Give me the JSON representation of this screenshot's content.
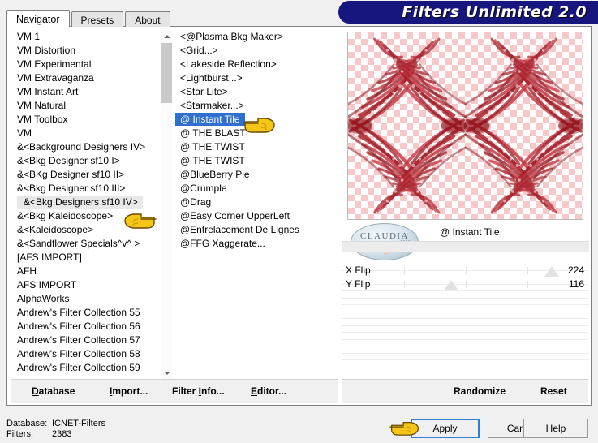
{
  "window": {
    "title": "Filters Unlimited 2.0",
    "accent_blue": "#16167e",
    "selection_blue": "#2f6fd0"
  },
  "tabs": [
    {
      "label": "Navigator",
      "active": true
    },
    {
      "label": "Presets",
      "active": false
    },
    {
      "label": "About",
      "active": false
    }
  ],
  "category_list": {
    "items": [
      {
        "label": "VM 1",
        "selected": false
      },
      {
        "label": "VM Distortion",
        "selected": false
      },
      {
        "label": "VM Experimental",
        "selected": false
      },
      {
        "label": "VM Extravaganza",
        "selected": false
      },
      {
        "label": "VM Instant Art",
        "selected": false
      },
      {
        "label": "VM Natural",
        "selected": false
      },
      {
        "label": "VM Toolbox",
        "selected": false
      },
      {
        "label": "VM",
        "selected": false
      },
      {
        "label": "&<Background Designers IV>",
        "selected": false
      },
      {
        "label": "&<Bkg Designer sf10 I>",
        "selected": false
      },
      {
        "label": "&<BKg Designer sf10 II>",
        "selected": false
      },
      {
        "label": "&<Bkg Designer sf10 III>",
        "selected": false
      },
      {
        "label": "&<Bkg Designers sf10 IV>",
        "selected": true
      },
      {
        "label": "&<Bkg Kaleidoscope>",
        "selected": false
      },
      {
        "label": "&<Kaleidoscope>",
        "selected": false
      },
      {
        "label": "&<Sandflower Specials^v^ >",
        "selected": false
      },
      {
        "label": "[AFS IMPORT]",
        "selected": false
      },
      {
        "label": "AFH",
        "selected": false
      },
      {
        "label": "AFS IMPORT",
        "selected": false
      },
      {
        "label": "AlphaWorks",
        "selected": false
      },
      {
        "label": "Andrew's Filter Collection 55",
        "selected": false
      },
      {
        "label": "Andrew's Filter Collection 56",
        "selected": false
      },
      {
        "label": "Andrew's Filter Collection 57",
        "selected": false
      },
      {
        "label": "Andrew's Filter Collection 58",
        "selected": false
      },
      {
        "label": "Andrew's Filter Collection 59",
        "selected": false
      }
    ],
    "scroll_up_icon": "chevron-up-icon",
    "scroll_down_icon": "chevron-down-icon"
  },
  "filter_list": {
    "items": [
      {
        "label": "<@Plasma Bkg Maker>",
        "selected": false
      },
      {
        "label": "<Grid...>",
        "selected": false
      },
      {
        "label": "<Lakeside Reflection>",
        "selected": false
      },
      {
        "label": "<Lightburst...>",
        "selected": false
      },
      {
        "label": "<Star Lite>",
        "selected": false
      },
      {
        "label": "<Starmaker...>",
        "selected": false
      },
      {
        "label": "@ Instant Tile",
        "selected": true
      },
      {
        "label": "@ THE BLAST",
        "selected": false
      },
      {
        "label": "@ THE TWIST",
        "selected": false
      },
      {
        "label": "@ THE TWIST",
        "selected": false
      },
      {
        "label": "@BlueBerry Pie",
        "selected": false
      },
      {
        "label": "@Crumple",
        "selected": false
      },
      {
        "label": "@Drag",
        "selected": false
      },
      {
        "label": "@Easy Corner UpperLeft",
        "selected": false
      },
      {
        "label": "@Entrelacement De Lignes",
        "selected": false
      },
      {
        "label": "@FFG Xaggerate...",
        "selected": false
      }
    ]
  },
  "preview": {
    "filter_name": "@ Instant Tile",
    "watermark": {
      "text": "CLAUDIA",
      "subtext": "2010",
      "icon": "dog-icon"
    }
  },
  "sliders": [
    {
      "label": "X Flip",
      "value": "224",
      "percent": 85
    },
    {
      "label": "Y Flip",
      "value": "116",
      "percent": 44
    },
    {
      "label": "",
      "value": "",
      "percent": -1
    },
    {
      "label": "",
      "value": "",
      "percent": -1
    },
    {
      "label": "",
      "value": "",
      "percent": -1
    },
    {
      "label": "",
      "value": "",
      "percent": -1
    },
    {
      "label": "",
      "value": "",
      "percent": -1
    }
  ],
  "panel_actions": {
    "randomize_label": "Randomize",
    "reset_label": "Reset"
  },
  "toolbar": {
    "database_label": "Database",
    "import_label": "Import...",
    "filter_info_label": "Filter Info...",
    "editor_label": "Editor..."
  },
  "status": {
    "database_label": "Database:",
    "database_value": "ICNET-Filters",
    "filters_label": "Filters:",
    "filters_value": "2383"
  },
  "dialog_buttons": {
    "apply_label": "Apply",
    "cancel_label": "Cancel",
    "help_label": "Help"
  },
  "cursors": {
    "pointing_hand_icon": "pointing-hand-icon"
  }
}
